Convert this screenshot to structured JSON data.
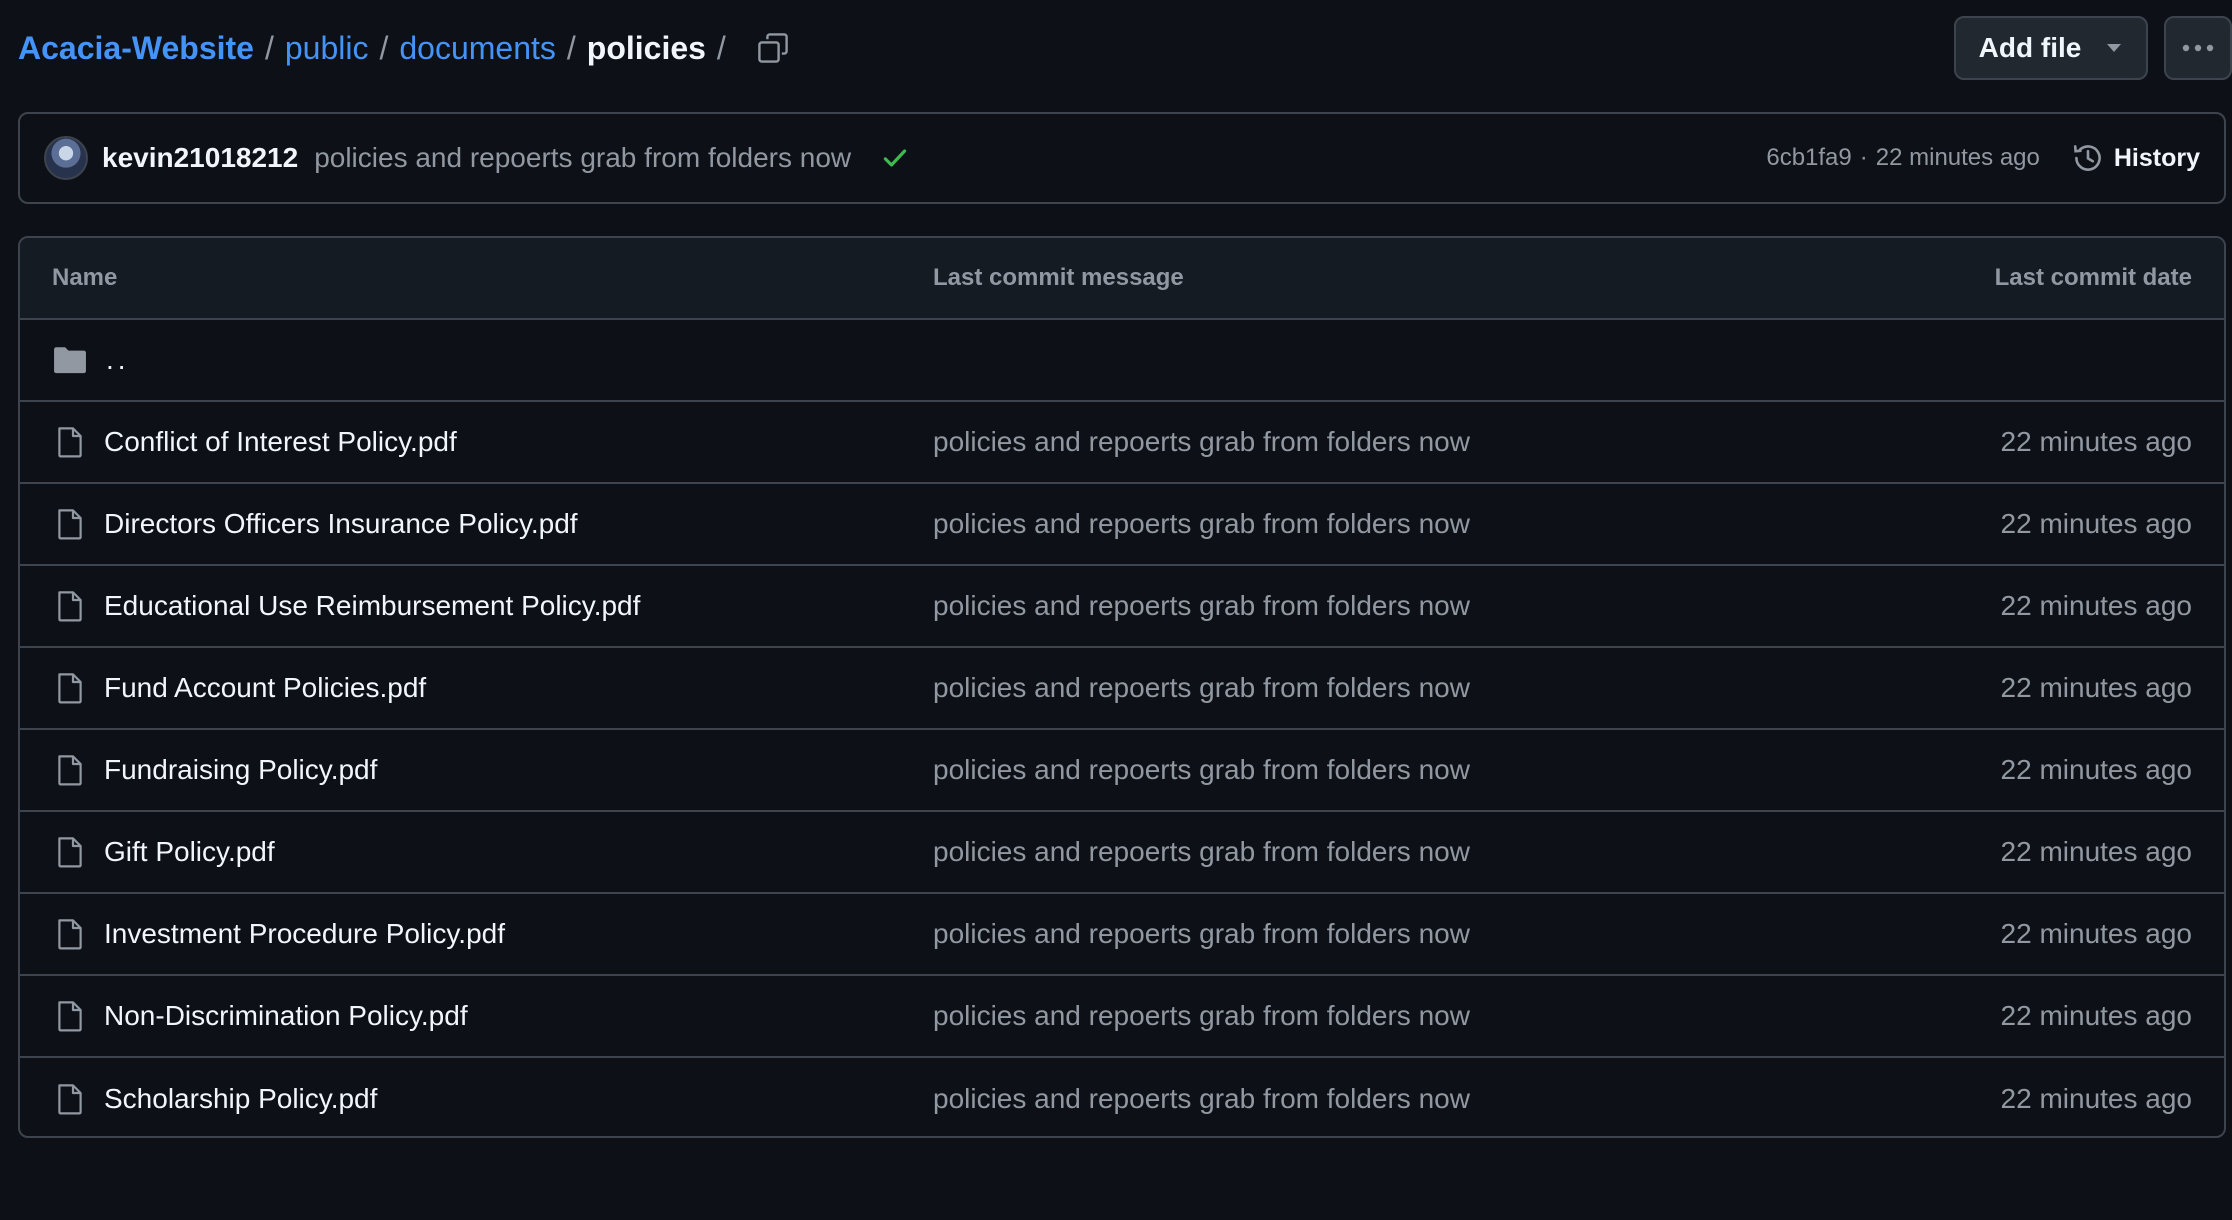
{
  "breadcrumb": {
    "repo": "Acacia-Website",
    "separator": "/",
    "folders": [
      "public",
      "documents"
    ],
    "current": "policies"
  },
  "header": {
    "add_file_label": "Add file"
  },
  "latest_commit": {
    "author": "kevin21018212",
    "message": "policies and repoerts grab from folders now",
    "status": "success",
    "sha": "6cb1fa9",
    "separator": "·",
    "time": "22 minutes ago",
    "history_label": "History"
  },
  "table": {
    "columns": {
      "name": "Name",
      "message": "Last commit message",
      "date": "Last commit date"
    },
    "parent_label": "..",
    "files": [
      {
        "name": "Conflict of Interest Policy.pdf",
        "message": "policies and repoerts grab from folders now",
        "date": "22 minutes ago"
      },
      {
        "name": "Directors Officers Insurance Policy.pdf",
        "message": "policies and repoerts grab from folders now",
        "date": "22 minutes ago"
      },
      {
        "name": "Educational Use Reimbursement Policy.pdf",
        "message": "policies and repoerts grab from folders now",
        "date": "22 minutes ago"
      },
      {
        "name": "Fund Account Policies.pdf",
        "message": "policies and repoerts grab from folders now",
        "date": "22 minutes ago"
      },
      {
        "name": "Fundraising Policy.pdf",
        "message": "policies and repoerts grab from folders now",
        "date": "22 minutes ago"
      },
      {
        "name": "Gift Policy.pdf",
        "message": "policies and repoerts grab from folders now",
        "date": "22 minutes ago"
      },
      {
        "name": "Investment Procedure Policy.pdf",
        "message": "policies and repoerts grab from folders now",
        "date": "22 minutes ago"
      },
      {
        "name": "Non-Discrimination Policy.pdf",
        "message": "policies and repoerts grab from folders now",
        "date": "22 minutes ago"
      },
      {
        "name": "Scholarship Policy.pdf",
        "message": "policies and repoerts grab from folders now",
        "date": "22 minutes ago"
      }
    ]
  },
  "icons": {
    "copy": "copy-icon",
    "caret": "triangle-down-icon",
    "more": "kebab-horizontal-icon",
    "check": "check-icon",
    "history": "history-icon",
    "folder": "folder-icon",
    "file": "file-icon"
  },
  "colors": {
    "background": "#0d1117",
    "link": "#4493f8",
    "border": "#3d444d",
    "muted_text": "#9198a1",
    "success": "#3fb950"
  }
}
